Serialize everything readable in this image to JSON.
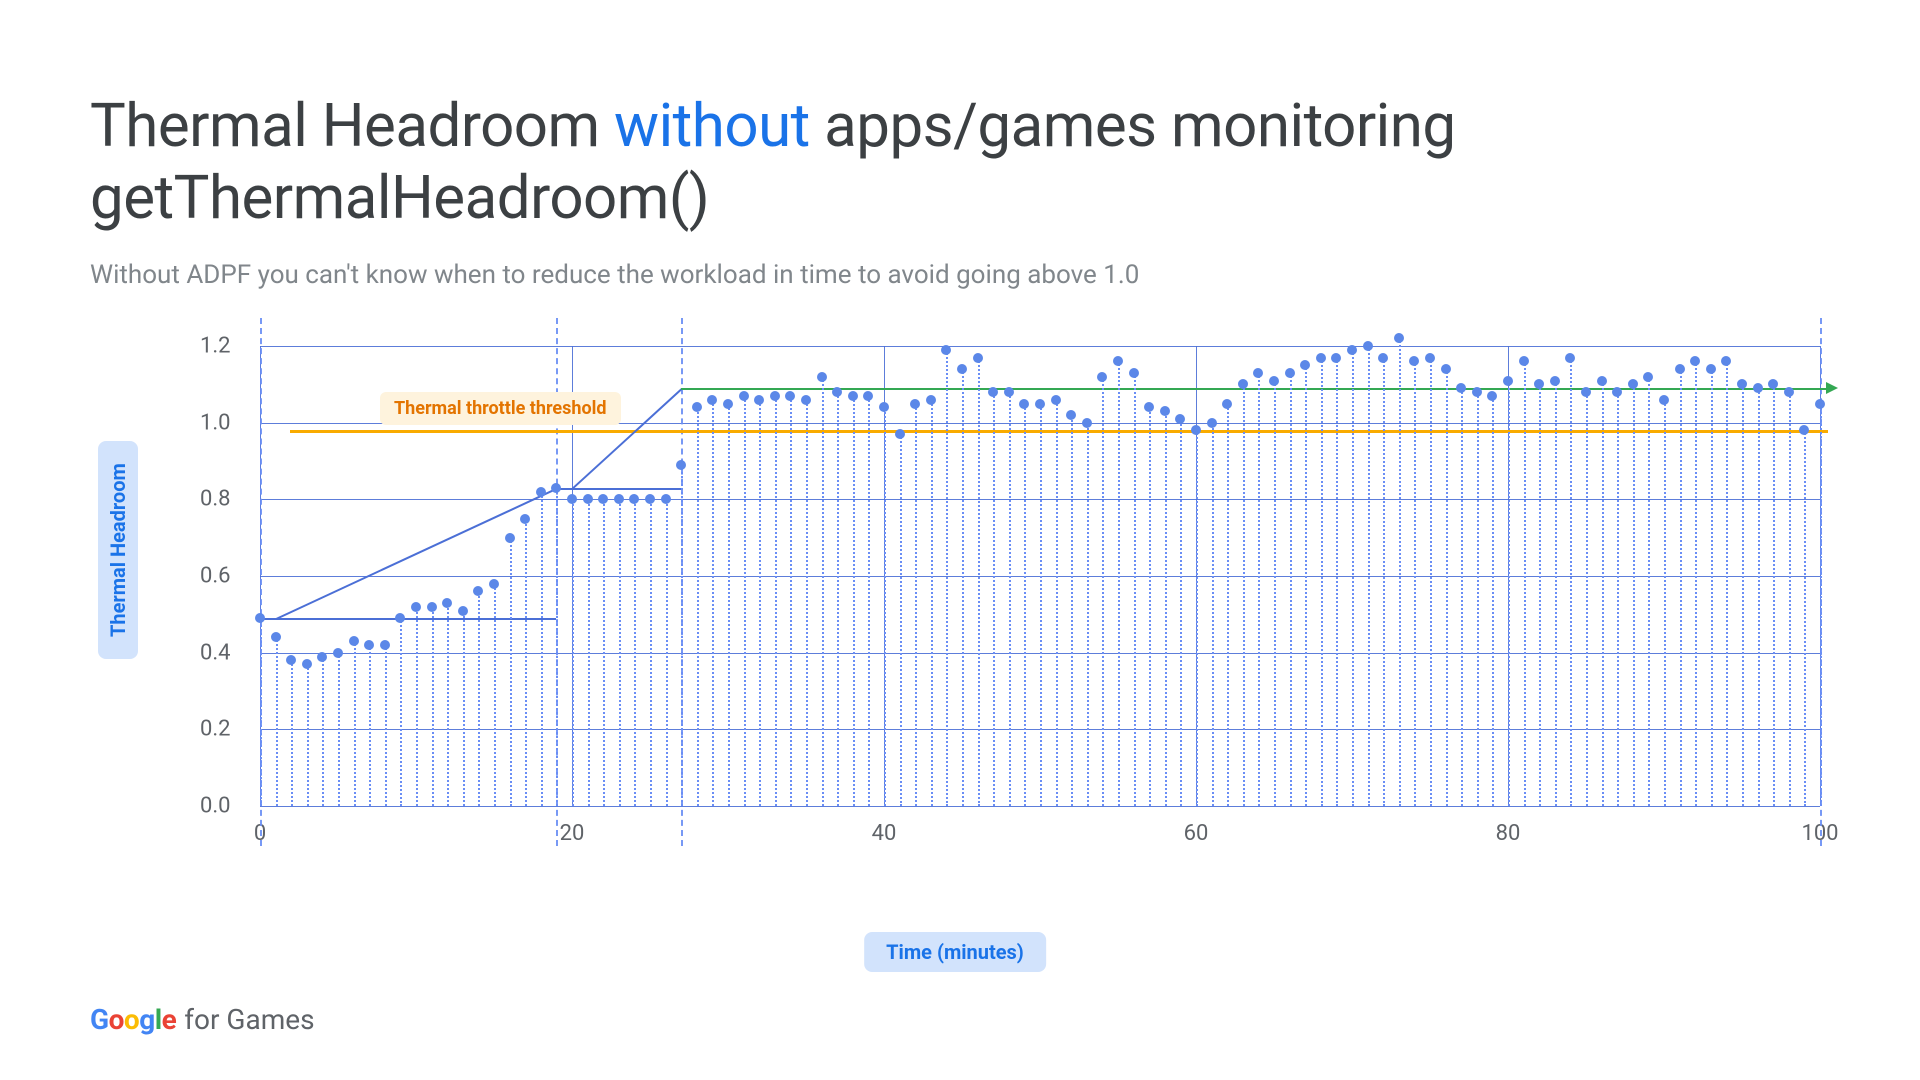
{
  "title_p1": "Thermal Headroom ",
  "title_hl": "without",
  "title_p2": " apps/games monitoring getThermalHeadroom()",
  "subtitle": "Without ADPF you can't know when to reduce the workload in time to avoid going above 1.0",
  "ylabel": "Thermal Headroom",
  "xlabel": "Time (minutes)",
  "threshold_label": "Thermal throttle threshold",
  "footer_suffix": " for Games",
  "logo": {
    "g": "G",
    "o1": "o",
    "o2": "o",
    "g2": "g",
    "l": "l",
    "e": "e"
  },
  "chart_data": {
    "type": "scatter",
    "title": "Thermal Headroom without apps/games monitoring getThermalHeadroom()",
    "xlabel": "Time (minutes)",
    "ylabel": "Thermal Headroom",
    "xlim": [
      0,
      100
    ],
    "ylim": [
      0.0,
      1.2
    ],
    "yticks": [
      0.0,
      0.2,
      0.4,
      0.6,
      0.8,
      1.0,
      1.2
    ],
    "xticks": [
      0,
      20,
      40,
      60,
      80,
      100
    ],
    "threshold_y": 0.98,
    "annotations": [
      "Thermal throttle threshold"
    ],
    "vguides": [
      0,
      19,
      27,
      100
    ],
    "steps": [
      {
        "x0": 0,
        "x1": 19,
        "y": 0.49
      },
      {
        "x0": 19,
        "x1": 27,
        "y": 0.83
      },
      {
        "x0": 27,
        "x1": 100,
        "y": 1.09
      }
    ],
    "x": [
      0,
      1,
      2,
      3,
      4,
      5,
      6,
      7,
      8,
      9,
      10,
      11,
      12,
      13,
      14,
      15,
      16,
      17,
      18,
      19,
      20,
      21,
      22,
      23,
      24,
      25,
      26,
      27,
      28,
      29,
      30,
      31,
      32,
      33,
      34,
      35,
      36,
      37,
      38,
      39,
      40,
      41,
      42,
      43,
      44,
      45,
      46,
      47,
      48,
      49,
      50,
      51,
      52,
      53,
      54,
      55,
      56,
      57,
      58,
      59,
      60,
      61,
      62,
      63,
      64,
      65,
      66,
      67,
      68,
      69,
      70,
      71,
      72,
      73,
      74,
      75,
      76,
      77,
      78,
      79,
      80,
      81,
      82,
      83,
      84,
      85,
      86,
      87,
      88,
      89,
      90,
      91,
      92,
      93,
      94,
      95,
      96,
      97,
      98,
      99,
      100
    ],
    "values": [
      0.49,
      0.44,
      0.38,
      0.37,
      0.39,
      0.4,
      0.43,
      0.42,
      0.42,
      0.49,
      0.52,
      0.52,
      0.53,
      0.51,
      0.56,
      0.58,
      0.7,
      0.75,
      0.82,
      0.83,
      0.8,
      0.8,
      0.8,
      0.8,
      0.8,
      0.8,
      0.8,
      0.89,
      1.04,
      1.06,
      1.05,
      1.07,
      1.06,
      1.07,
      1.07,
      1.06,
      1.12,
      1.08,
      1.07,
      1.07,
      1.04,
      0.97,
      1.05,
      1.06,
      1.19,
      1.14,
      1.17,
      1.08,
      1.08,
      1.05,
      1.05,
      1.06,
      1.02,
      1.0,
      1.12,
      1.16,
      1.13,
      1.04,
      1.03,
      1.01,
      0.98,
      1.0,
      1.05,
      1.1,
      1.13,
      1.11,
      1.13,
      1.15,
      1.17,
      1.17,
      1.19,
      1.2,
      1.17,
      1.22,
      1.16,
      1.17,
      1.14,
      1.09,
      1.08,
      1.07,
      1.11,
      1.16,
      1.1,
      1.11,
      1.17,
      1.08,
      1.11,
      1.08,
      1.1,
      1.12,
      1.06,
      1.14,
      1.16,
      1.14,
      1.16,
      1.1,
      1.09,
      1.1,
      1.08,
      0.98,
      1.05
    ]
  }
}
